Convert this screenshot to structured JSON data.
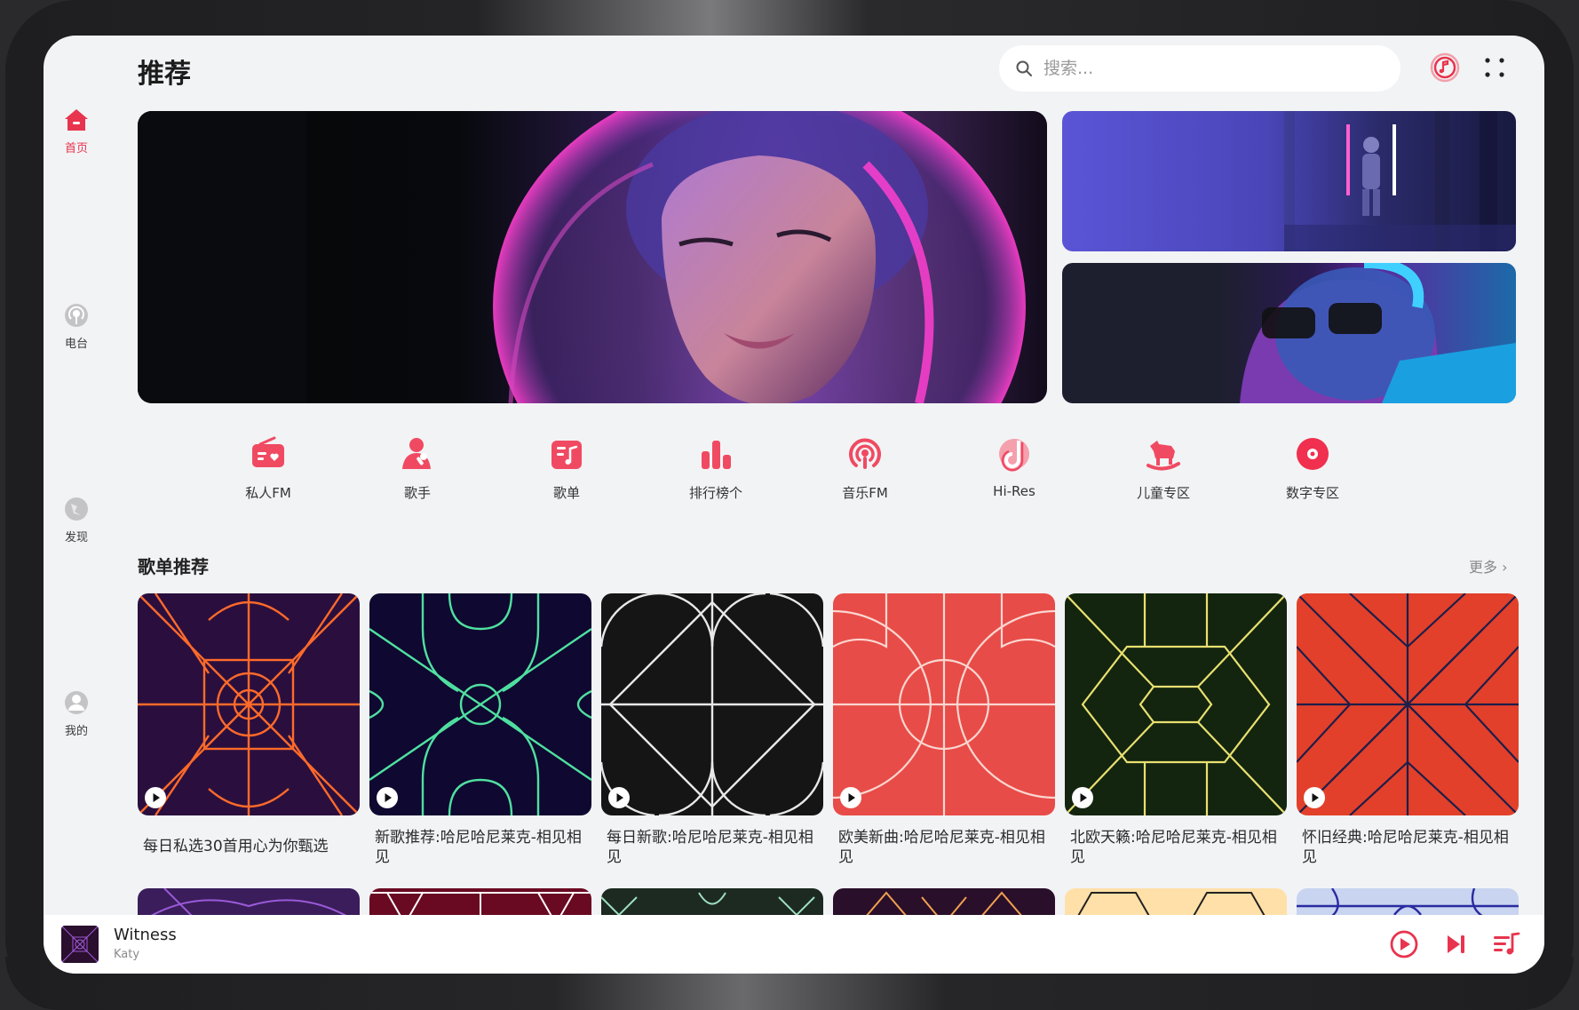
{
  "header": {
    "title": "推荐",
    "search_placeholder": "搜索..."
  },
  "sidebar": {
    "items": [
      {
        "label": "首页",
        "icon": "home-icon",
        "active": true
      },
      {
        "label": "电台",
        "icon": "radio-icon",
        "active": false
      },
      {
        "label": "发现",
        "icon": "discover-icon",
        "active": false
      },
      {
        "label": "我的",
        "icon": "user-icon",
        "active": false
      }
    ]
  },
  "quick_entries": [
    {
      "label": "私人FM",
      "icon": "fm-radio-icon"
    },
    {
      "label": "歌手",
      "icon": "singer-icon"
    },
    {
      "label": "歌单",
      "icon": "playlist-icon"
    },
    {
      "label": "排行榜个",
      "icon": "chart-bars-icon"
    },
    {
      "label": "音乐FM",
      "icon": "podcast-icon"
    },
    {
      "label": "Hi-Res",
      "icon": "hires-icon"
    },
    {
      "label": "儿童专区",
      "icon": "rocking-horse-icon"
    },
    {
      "label": "数字专区",
      "icon": "vinyl-disc-icon"
    }
  ],
  "section": {
    "title": "歌单推荐",
    "more": "更多"
  },
  "playlists": [
    {
      "name": "每日私选30首用心为你甄选",
      "bg": "#2a0f3e",
      "line": "#ff6a2a"
    },
    {
      "name": "新歌推荐:哈尼哈尼莱克-相见相见",
      "bg": "#0f0830",
      "line": "#4fe0a0"
    },
    {
      "name": "每日新歌:哈尼哈尼莱克-相见相见",
      "bg": "#151515",
      "line": "#e8e8e8"
    },
    {
      "name": "欧美新曲:哈尼哈尼莱克-相见相见",
      "bg": "#e84c48",
      "line": "#fbd6d0"
    },
    {
      "name": "北欧天籁:哈尼哈尼莱克-相见相见",
      "bg": "#13250f",
      "line": "#e8e070"
    },
    {
      "name": "怀旧经典:哈尼哈尼莱克-相见相见",
      "bg": "#e2402a",
      "line": "#1d1e4a"
    }
  ],
  "second_row_colors": [
    "#3a1d5a",
    "#6a0a22",
    "#1d2a22",
    "#2a0f2a",
    "#ffe0a8",
    "#c8d4f0"
  ],
  "player": {
    "song": "Witness",
    "artist": "Katy"
  },
  "accent": "#e8344e"
}
